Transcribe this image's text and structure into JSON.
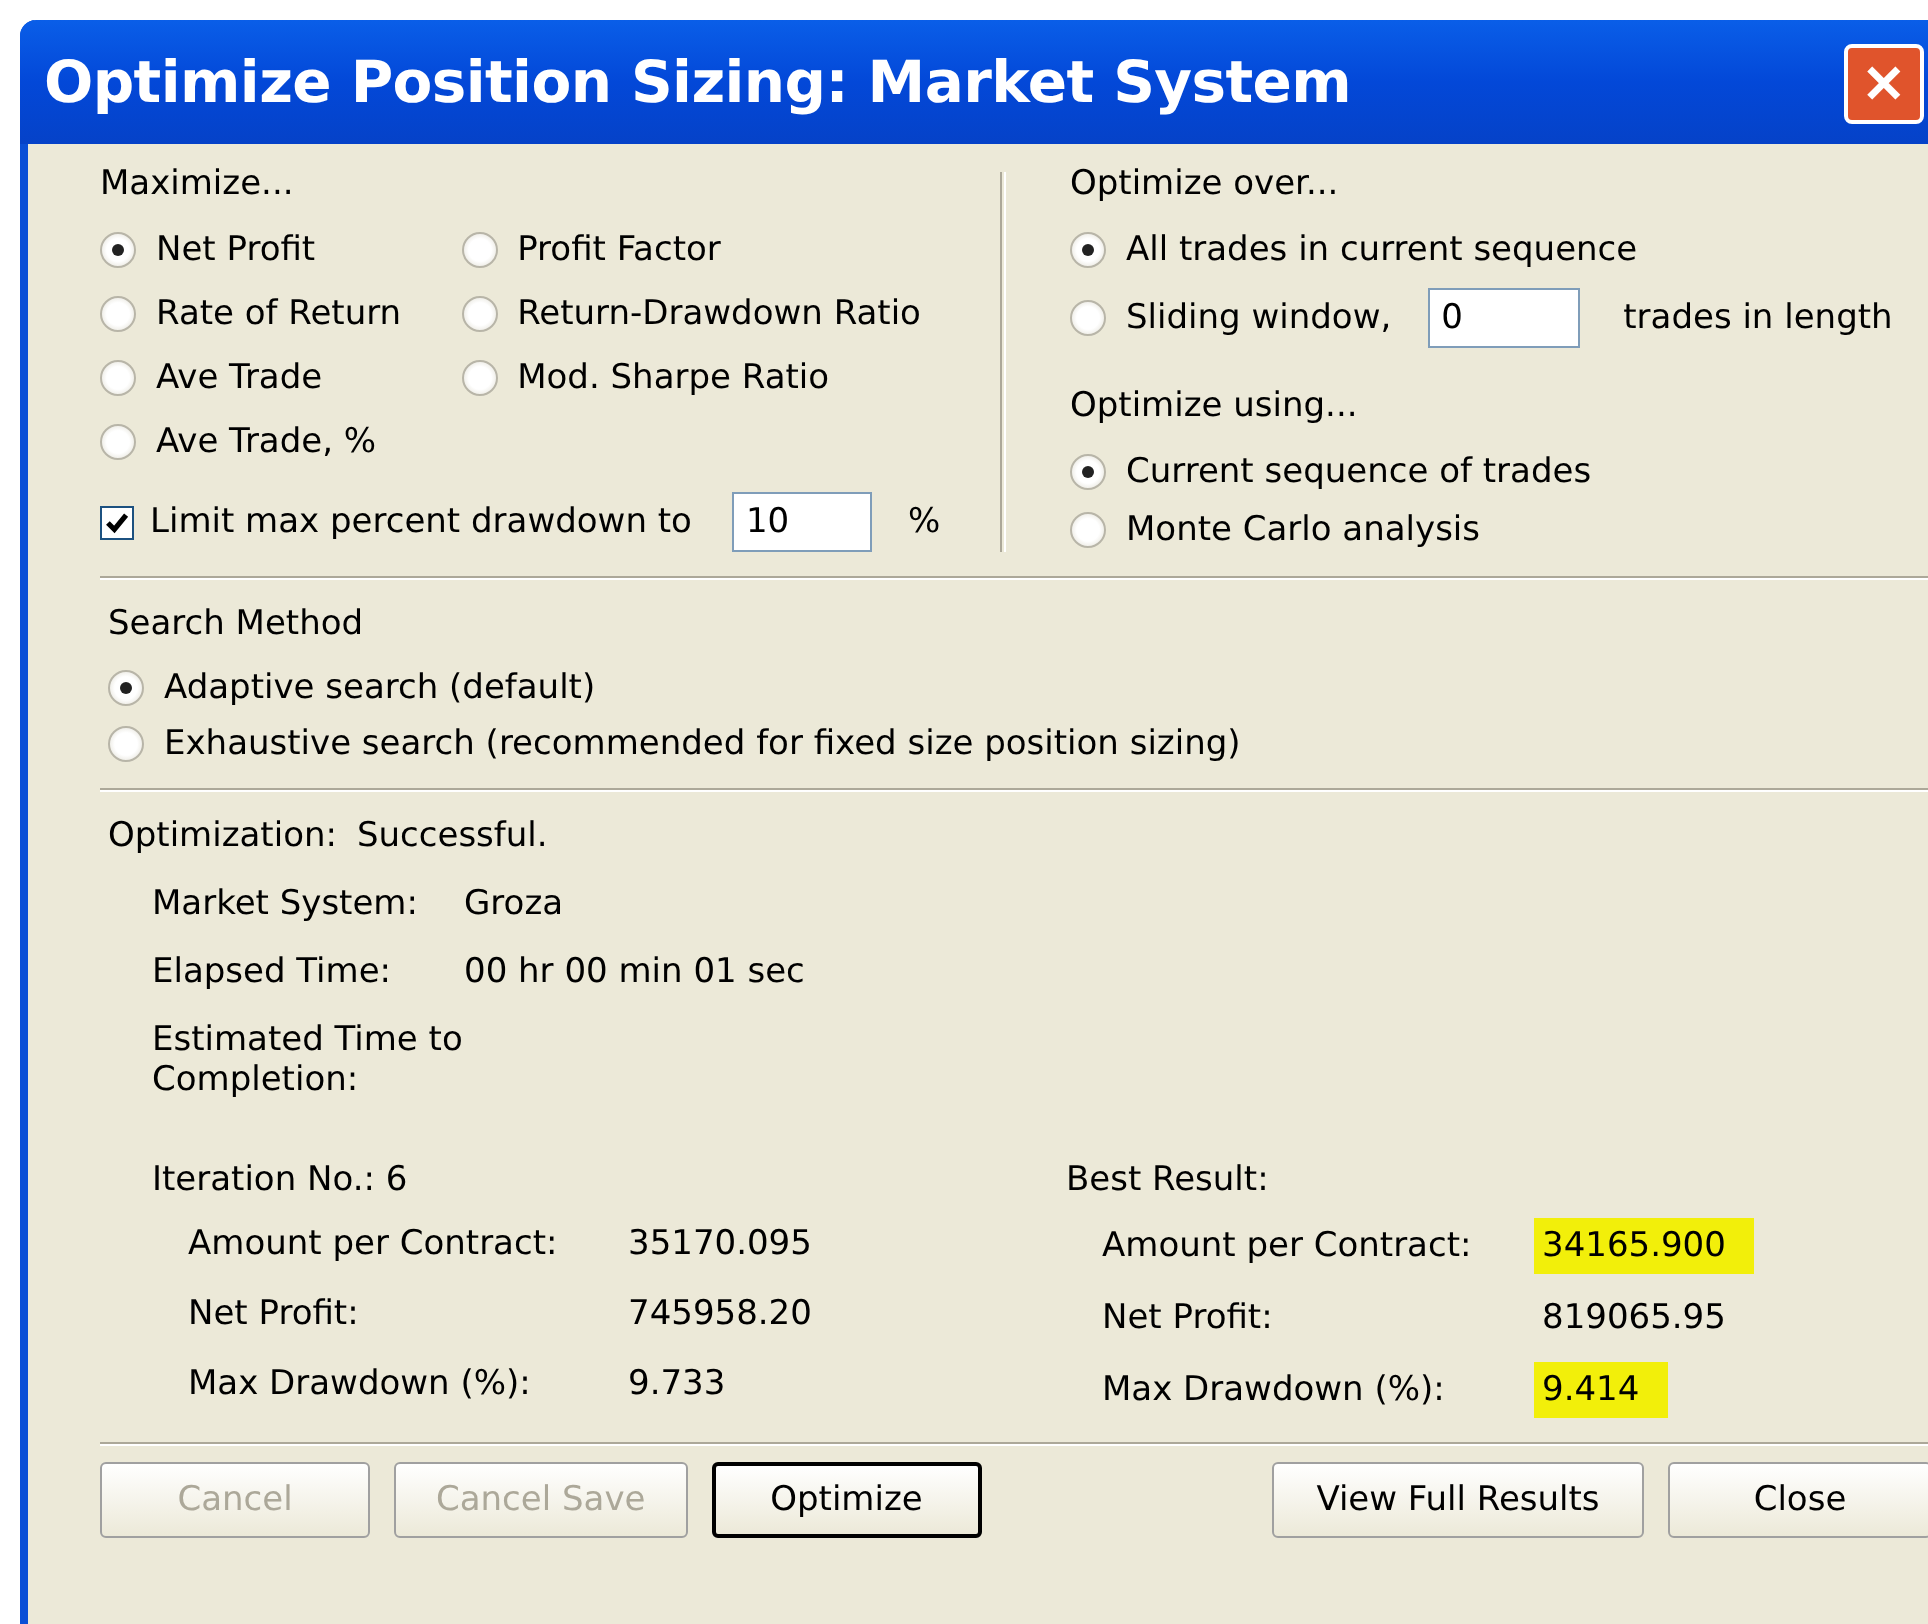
{
  "window": {
    "title": "Optimize Position Sizing: Market System",
    "close": "✕"
  },
  "maximize": {
    "label": "Maximize...",
    "options": [
      {
        "label": "Net Profit",
        "selected": true
      },
      {
        "label": "Rate of Return",
        "selected": false
      },
      {
        "label": "Ave Trade",
        "selected": false
      },
      {
        "label": "Ave Trade, %",
        "selected": false
      },
      {
        "label": "Profit Factor",
        "selected": false
      },
      {
        "label": "Return-Drawdown Ratio",
        "selected": false
      },
      {
        "label": "Mod. Sharpe Ratio",
        "selected": false
      }
    ],
    "limit": {
      "label": "Limit max percent drawdown to",
      "checked": true,
      "value": "10",
      "unit": "%"
    }
  },
  "optimize_over": {
    "label": "Optimize over...",
    "options": [
      {
        "kind": "plain",
        "label": "All trades in current sequence",
        "selected": true
      },
      {
        "kind": "field",
        "label": "Sliding window,",
        "selected": false,
        "value": "0",
        "suffix": "trades in length"
      }
    ]
  },
  "optimize_using": {
    "label": "Optimize using...",
    "options": [
      {
        "label": "Current sequence of trades",
        "selected": true
      },
      {
        "label": "Monte Carlo analysis",
        "selected": false
      }
    ]
  },
  "search_method": {
    "label": "Search Method",
    "options": [
      {
        "label": "Adaptive search (default)",
        "selected": true
      },
      {
        "label": "Exhaustive search (recommended for fixed size position sizing)",
        "selected": false
      }
    ]
  },
  "status": {
    "label": "Optimization:",
    "value": "Successful.",
    "info": [
      {
        "label": "Market System:",
        "value": "Groza"
      },
      {
        "label": "Elapsed Time:",
        "value": "00 hr 00 min 01 sec"
      },
      {
        "label": "Estimated Time to Completion:"
      }
    ]
  },
  "iteration": {
    "label": "Iteration No.:",
    "value": "6",
    "rows": [
      {
        "label": "Amount per Contract:",
        "value": "35170.095",
        "highlighted": false
      },
      {
        "label": "Net Profit:",
        "value": "745958.20",
        "highlighted": false
      },
      {
        "label": "Max Drawdown (%):",
        "value": "9.733",
        "highlighted": false
      }
    ]
  },
  "best": {
    "label": "Best Result:",
    "rows": [
      {
        "label": "Amount per Contract:",
        "value": "34165.900",
        "highlighted": true
      },
      {
        "label": "Net Profit:",
        "value": "819065.95",
        "highlighted": false
      },
      {
        "label": "Max Drawdown (%):",
        "value": "9.414",
        "highlighted": true
      }
    ]
  },
  "buttons": [
    {
      "label": "Cancel",
      "disabled": true,
      "default": false
    },
    {
      "label": "Cancel Save",
      "disabled": true,
      "default": false
    },
    {
      "label": "Optimize",
      "disabled": false,
      "default": true
    },
    {
      "label": "View Full Results",
      "disabled": false,
      "default": false
    },
    {
      "label": "Close",
      "disabled": false,
      "default": false
    }
  ]
}
